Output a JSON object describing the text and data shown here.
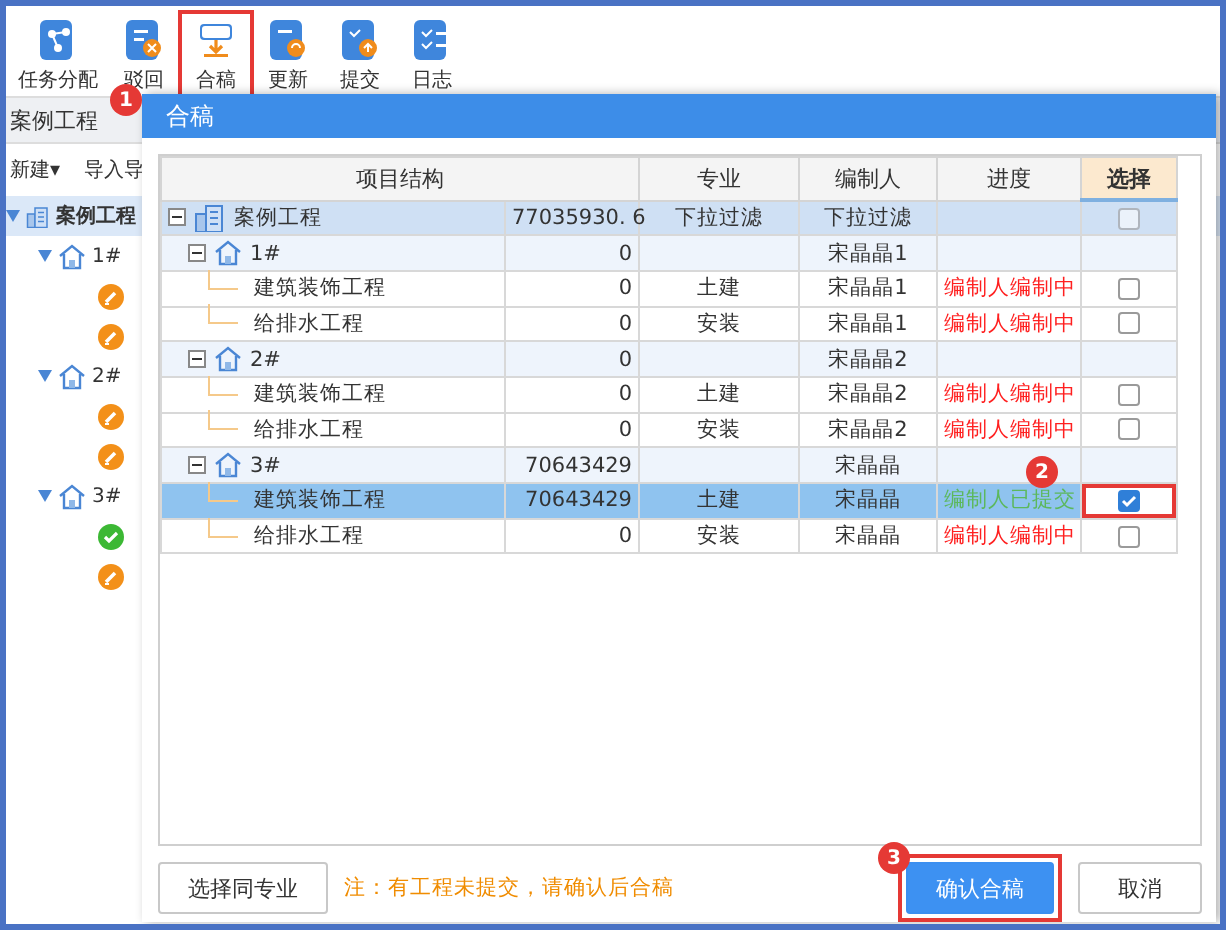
{
  "toolbar": {
    "items": [
      {
        "label": "任务分配",
        "kind": "assign",
        "highlighted": false
      },
      {
        "label": "驳回",
        "kind": "reject",
        "highlighted": false
      },
      {
        "label": "合稿",
        "kind": "merge",
        "highlighted": true,
        "badge": "1"
      },
      {
        "label": "更新",
        "kind": "update",
        "highlighted": false
      },
      {
        "label": "提交",
        "kind": "submit",
        "highlighted": false
      },
      {
        "label": "日志",
        "kind": "log",
        "highlighted": false
      }
    ]
  },
  "sidebar": {
    "title": "案例工程",
    "actions": [
      "新建▾",
      "导入导"
    ],
    "tree": [
      {
        "label": "案例工程",
        "kind": "project",
        "selected": true,
        "children": [
          {
            "label": "1#",
            "kind": "building",
            "children": [
              {
                "kind": "task",
                "submitted": false
              },
              {
                "kind": "task",
                "submitted": false
              }
            ]
          },
          {
            "label": "2#",
            "kind": "building",
            "children": [
              {
                "kind": "task",
                "submitted": false
              },
              {
                "kind": "task",
                "submitted": false
              }
            ]
          },
          {
            "label": "3#",
            "kind": "building",
            "children": [
              {
                "kind": "task",
                "submitted": true
              },
              {
                "kind": "task",
                "submitted": false
              }
            ]
          }
        ]
      }
    ]
  },
  "dialog": {
    "title": "合稿",
    "columns": [
      "项目结构",
      "专业",
      "编制人",
      "进度",
      "选择"
    ],
    "rows": [
      {
        "name": "案例工程",
        "kind": "project",
        "amount": "77035930. 6",
        "specialty": "下拉过滤",
        "editor": "下拉过滤",
        "checked": false,
        "selected": false,
        "children": [
          {
            "name": "1#",
            "kind": "building",
            "amount": "0",
            "editor": "宋晶晶1",
            "selected": false,
            "children": [
              {
                "name": "建筑装饰工程",
                "kind": "unit",
                "amount": "0",
                "specialty": "土建",
                "editor": "宋晶晶1",
                "progress": "编制人编制中",
                "color": "#ff2020",
                "checked": false,
                "selected": false
              },
              {
                "name": "给排水工程",
                "kind": "unit",
                "amount": "0",
                "specialty": "安装",
                "editor": "宋晶晶1",
                "progress": "编制人编制中",
                "color": "#ff2020",
                "checked": false,
                "selected": false
              }
            ]
          },
          {
            "name": "2#",
            "kind": "building",
            "amount": "0",
            "editor": "宋晶晶2",
            "selected": false,
            "children": [
              {
                "name": "建筑装饰工程",
                "kind": "unit",
                "amount": "0",
                "specialty": "土建",
                "editor": "宋晶晶2",
                "progress": "编制人编制中",
                "color": "#ff2020",
                "checked": false,
                "selected": false
              },
              {
                "name": "给排水工程",
                "kind": "unit",
                "amount": "0",
                "specialty": "安装",
                "editor": "宋晶晶2",
                "progress": "编制人编制中",
                "color": "#ff2020",
                "checked": false,
                "selected": false
              }
            ]
          },
          {
            "name": "3#",
            "kind": "building",
            "amount": "70643429",
            "editor": "宋晶晶",
            "selected": false,
            "children": [
              {
                "name": "建筑装饰工程",
                "kind": "unit",
                "amount": "70643429",
                "specialty": "土建",
                "editor": "宋晶晶",
                "progress": "编制人已提交",
                "color": "#5cb85c",
                "checked": true,
                "selected": true,
                "highlighted": true,
                "badge": "2"
              },
              {
                "name": "给排水工程",
                "kind": "unit",
                "amount": "0",
                "specialty": "安装",
                "editor": "宋晶晶",
                "progress": "编制人编制中",
                "color": "#ff2020",
                "checked": false,
                "selected": false
              }
            ]
          }
        ]
      }
    ],
    "footer": {
      "select_button": "选择同专业",
      "note": "注：有工程未提交，请确认后合稿",
      "confirm": {
        "label": "确认合稿",
        "highlighted": true,
        "badge": "3"
      },
      "cancel": "取消"
    }
  }
}
